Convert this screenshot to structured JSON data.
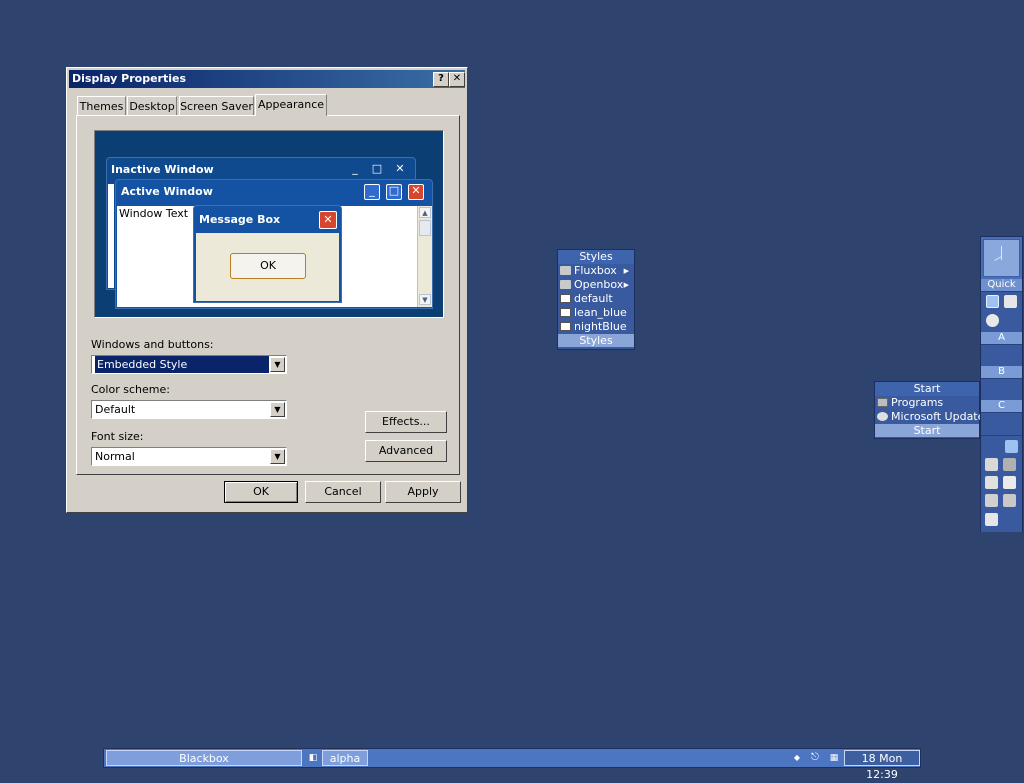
{
  "dialog": {
    "title": "Display Properties",
    "help_btn": "?",
    "close_btn": "✕",
    "tabs": [
      {
        "label": "Themes"
      },
      {
        "label": "Desktop"
      },
      {
        "label": "Screen Saver"
      },
      {
        "label": "Appearance"
      }
    ],
    "preview": {
      "inactive_title": "Inactive Window",
      "active_title": "Active Window",
      "window_text": "Window Text",
      "msgbox_title": "Message Box",
      "ok": "OK"
    },
    "windows_buttons_label": "Windows and buttons:",
    "windows_buttons_value": "Embedded Style",
    "color_scheme_label": "Color scheme:",
    "color_scheme_value": "Default",
    "font_size_label": "Font size:",
    "font_size_value": "Normal",
    "effects_btn": "Effects...",
    "advanced_btn": "Advanced",
    "ok_btn": "OK",
    "cancel_btn": "Cancel",
    "apply_btn": "Apply"
  },
  "styles_menu": {
    "header": "Styles",
    "items": [
      {
        "label": "Fluxbox",
        "icon": "folder-icon",
        "submenu": true
      },
      {
        "label": "Openbox",
        "icon": "folder-icon",
        "submenu": true
      },
      {
        "label": "default",
        "icon": "style-file-icon",
        "submenu": false
      },
      {
        "label": "lean_blue",
        "icon": "style-file-icon",
        "submenu": false
      },
      {
        "label": "nightBlue",
        "icon": "style-file-icon",
        "submenu": false
      }
    ],
    "footer": "Styles"
  },
  "start_menu": {
    "header": "Start",
    "items": [
      {
        "label": "Programs",
        "icon": "programs-icon"
      },
      {
        "label": "Microsoft Update",
        "icon": "update-icon"
      }
    ],
    "footer": "Start"
  },
  "slit": {
    "quick_label": "Quick",
    "sections": [
      "A",
      "B",
      "C"
    ]
  },
  "taskbar": {
    "workspace": "Blackbox",
    "task": "alpha",
    "clock": "18 Mon 12:39"
  },
  "colors": {
    "desktop": "#2f436f",
    "dialog_face": "#d4d0c8",
    "menu": "#3a5aa0",
    "taskbar": "#4d76c2"
  }
}
